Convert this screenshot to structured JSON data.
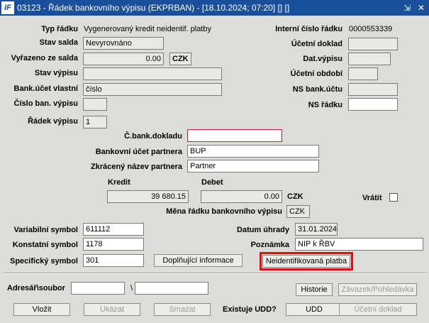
{
  "window": {
    "title": "03123 - Řádek bankovního výpisu (EKPRBAN) - [18.10.2024; 07:20] [] []",
    "app_icon": "IF",
    "controls": {
      "minimize": "⇲",
      "close": "✕"
    }
  },
  "labels": {
    "typ_radku": "Typ řádku",
    "stav_salda": "Stav salda",
    "vyrazeno": "Vyřazeno ze salda",
    "stav_vypisu": "Stav výpisu",
    "bank_ucet_vlastni": "Bank.účet vlastní",
    "cislo_ban_vypisu": "Číslo ban. výpisu",
    "radek_vypisu": "Řádek výpisu",
    "interni_cislo_radku": "Interní číslo řádku",
    "ucetni_doklad": "Účetní doklad",
    "dat_vypisu": "Dat.výpisu",
    "ucetni_obdobi": "Účetní období",
    "ns_bank_uctu": "NS bank.účtu",
    "ns_radku": "NS řádku",
    "c_bank_dokladu": "Č.bank.dokladu",
    "bankovni_ucet_partnera": "Bankovní účet partnera",
    "zkraceny_nazev_partnera": "Zkrácený název partnera",
    "kredit": "Kredit",
    "debet": "Debet",
    "czk_currency": "CZK",
    "vratit": "Vrátit",
    "mena_radku": "Měna řádku bankovního výpisu",
    "variabilni_symbol": "Variabilní symbol",
    "konstatni_symbol": "Konstatní symbol",
    "specificky_symbol": "Specifický symbol",
    "datum_uhrady": "Datum úhrady",
    "poznamka": "Poznámka",
    "adresar_soubor": "Adresář\\soubor",
    "backslash": "\\",
    "existuje_udd": "Existuje UDD?"
  },
  "values": {
    "typ_radku": "Vygenerovaný kredit neidentif. platby",
    "interni_cislo_radku": "0000553339",
    "stav_salda": "Nevyrovnáno",
    "vyrazeno": "0.00",
    "vyrazeno_mena": "CZK",
    "bank_ucet_vlastni": "číslo",
    "radek_vypisu": "1",
    "c_bank_dokladu": "",
    "bankovni_ucet_partnera": "BUP",
    "zkraceny_nazev_partnera": "Partner",
    "kredit": "39 680.15",
    "debet": "0.00",
    "mena_radku": "CZK",
    "variabilni_symbol": "611112",
    "konstatni_symbol": "1178",
    "specificky_symbol": "301",
    "datum_uhrady": "31.01.2024",
    "poznamka": "NIP k ŘBV"
  },
  "buttons": {
    "doplnujici_informace": "Doplňující informace",
    "neidentifikovana_platba": "Neidentifikovaná platba",
    "historie": "Historie",
    "zavazek_pohledavka": "Závazek/Pohledávka",
    "vlozit": "Vložit",
    "ukazat": "Ukázat",
    "smazat": "Smazat",
    "udd": "UDD",
    "ucetni_doklad": "Účetní doklad"
  },
  "colors": {
    "titlebar": "#1a4f9c",
    "highlight": "#e01010"
  }
}
